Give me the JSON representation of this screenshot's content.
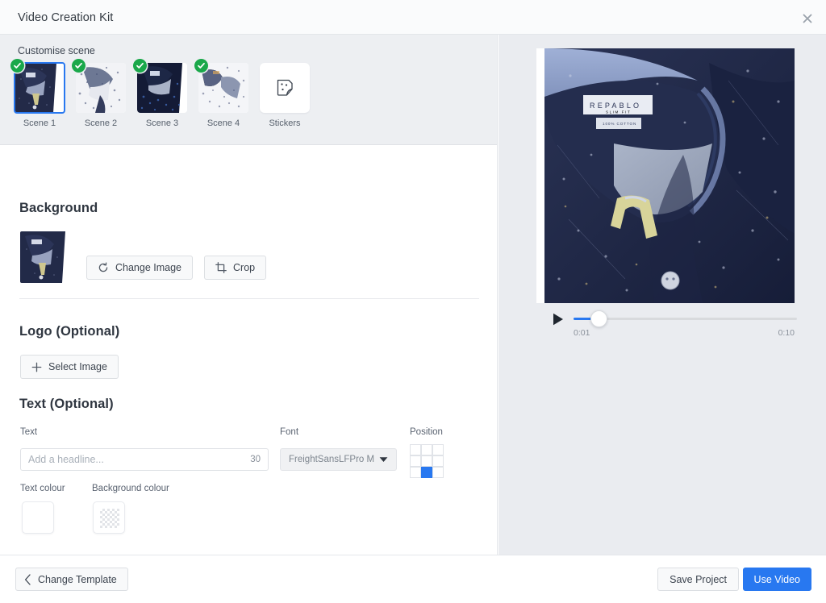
{
  "window": {
    "title": "Video Creation Kit",
    "close_icon": "close-icon"
  },
  "scene_strip": {
    "label": "Customise scene",
    "scenes": [
      {
        "label": "Scene 1",
        "selected": true,
        "checked": true
      },
      {
        "label": "Scene 2",
        "selected": false,
        "checked": true
      },
      {
        "label": "Scene 3",
        "selected": false,
        "checked": true
      },
      {
        "label": "Scene 4",
        "selected": false,
        "checked": true
      }
    ],
    "stickers": {
      "label": "Stickers",
      "icon": "sticker-icon"
    }
  },
  "background": {
    "title": "Background",
    "change_image_label": "Change Image",
    "change_image_icon": "refresh-icon",
    "crop_label": "Crop",
    "crop_icon": "crop-icon"
  },
  "logo": {
    "title": "Logo (Optional)",
    "select_image_label": "Select Image",
    "select_image_icon": "plus-icon"
  },
  "text_section": {
    "title": "Text (Optional)",
    "text_label": "Text",
    "text_value": "",
    "text_placeholder": "Add a headline...",
    "char_count": "30",
    "font_label": "Font",
    "font_value": "FreightSansLFPro M",
    "font_caret_icon": "chevron-down-icon",
    "position_label": "Position",
    "position_selected_index": 7,
    "text_colour_label": "Text colour",
    "text_colour_value": "#ffffff",
    "background_colour_label": "Background colour",
    "background_colour_value": "transparent"
  },
  "preview": {
    "play_icon": "play-icon",
    "current_time": "0:01",
    "total_time": "0:10",
    "progress_percent": 10,
    "image_alt": "navy speckled dress shirt collar with REPABLO label",
    "brand_label": "REPABLO",
    "brand_sub": "SLIM FIT",
    "care_label": "100% COTTON"
  },
  "footer": {
    "change_template_label": "Change Template",
    "change_template_icon": "chevron-left-icon",
    "save_project_label": "Save Project",
    "use_video_label": "Use Video"
  },
  "colors": {
    "accent": "#2878f0",
    "check_green": "#1aa84a",
    "panel_bg": "#eaecf0",
    "strip_bg": "#edeff2",
    "titlebar_bg": "#fafbfc"
  }
}
